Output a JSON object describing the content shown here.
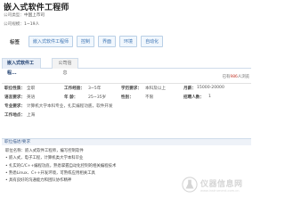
{
  "job": {
    "title": "嵌入式软件工程师",
    "company_type_label": "公司类型：",
    "company_type": "中国上市司",
    "company_size_label": "公司规模：",
    "company_size": "1~19人"
  },
  "tags": {
    "label": "标签",
    "items": [
      "嵌入式软件工程师",
      "控制",
      "界面",
      "环境",
      "自动化"
    ]
  },
  "tabs": [
    "嵌入式软件工程...",
    "公司信息"
  ],
  "meta": {
    "prefix": "已有",
    "count": "986",
    "suffix": "人浏览"
  },
  "details": {
    "category_label": "职位性质：",
    "category": "全职",
    "experience_label": "工作经验：",
    "experience": "3~5年",
    "education_label": "学历要求：",
    "education": "本科及以上",
    "salary_label": "月薪：",
    "salary": "15000-20000",
    "language_label": "语言要求：",
    "language": "英语",
    "age_label": "年 龄：",
    "age": "25~35岁",
    "gender_label": "性别：",
    "gender": "不限",
    "headcount_label": "招聘人数：",
    "headcount": "1",
    "major_label": "专业要求：",
    "major": "计算机大学本科专业，扎实编程功底，软件开发",
    "location_label": "工作地点：",
    "location": "上海"
  },
  "section": {
    "title": "职位描述/要求"
  },
  "description": [
    "职位名称：嵌入式软件工程师，编写控制软件",
    "• 嵌入式，电子工程，计算机类大学本科毕业",
    "• 扎实的C/C++编程功底，熟悉掌握自动化控制的相关编程技术",
    "• 熟悉Linux、C++开发环境，可熟练应用相关工具",
    "• 具有良好的沟通能力和团队协作精神"
  ],
  "watermark": {
    "name": "仪器信息网",
    "url": "www.instrument.com.cn"
  }
}
